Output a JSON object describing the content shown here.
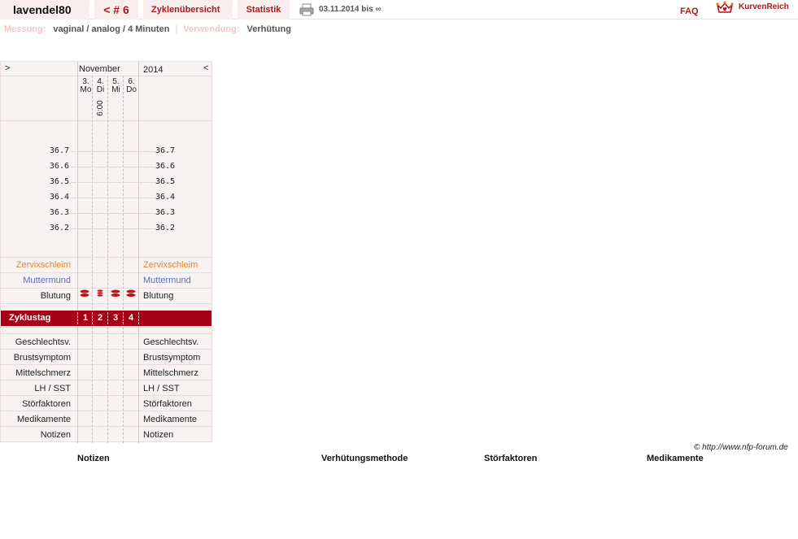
{
  "header": {
    "username": "lavendel80",
    "cycle_label": "< # 6",
    "tabs": {
      "overview": "Zyklenübersicht",
      "statistics": "Statistik"
    },
    "print_icon": "printer-icon",
    "date_range": "03.11.2014 bis ∞",
    "faq": "FAQ",
    "brand": "KurvenReich",
    "brand_icon": "crown-heart-icon"
  },
  "subheader": {
    "measure_label": "Messung:",
    "measure_value": "vaginal / analog / 4 Minuten",
    "separator": "|",
    "usage_label": "Verwendung:",
    "usage_value": "Verhütung"
  },
  "chart": {
    "nav_left": ">",
    "nav_right": "<",
    "month": "November",
    "year": "2014",
    "days": [
      {
        "num": "3.",
        "wd": "Mo"
      },
      {
        "num": "4.",
        "wd": "Di"
      },
      {
        "num": "5.",
        "wd": "Mi"
      },
      {
        "num": "6.",
        "wd": "Do"
      }
    ],
    "time": "6:00",
    "temperatures": [
      "36.7",
      "36.6",
      "36.5",
      "36.4",
      "36.3",
      "36.2"
    ],
    "rows_upper": {
      "cervical": "Zervixschleim",
      "cervix": "Muttermund",
      "bleeding": "Blutung"
    },
    "bleeding_icon": "blood-drop-icon",
    "cycle_day_label": "Zyklustag",
    "cycle_days": [
      "1",
      "2",
      "3",
      "4"
    ],
    "rows_lower": [
      "Geschlechtsv.",
      "Brustsymptom",
      "Mittelschmerz",
      "LH / SST",
      "Störfaktoren",
      "Medikamente",
      "Notizen"
    ],
    "colors": {
      "accent": "#a60019",
      "cervical": "#e88422",
      "cervix": "#5b6cc0",
      "blood": "#c0101a"
    }
  },
  "footer": {
    "copyright": "© http://www.nfp-forum.de",
    "headings": [
      "Notizen",
      "Verhütungsmethode",
      "Störfaktoren",
      "Medikamente"
    ]
  }
}
